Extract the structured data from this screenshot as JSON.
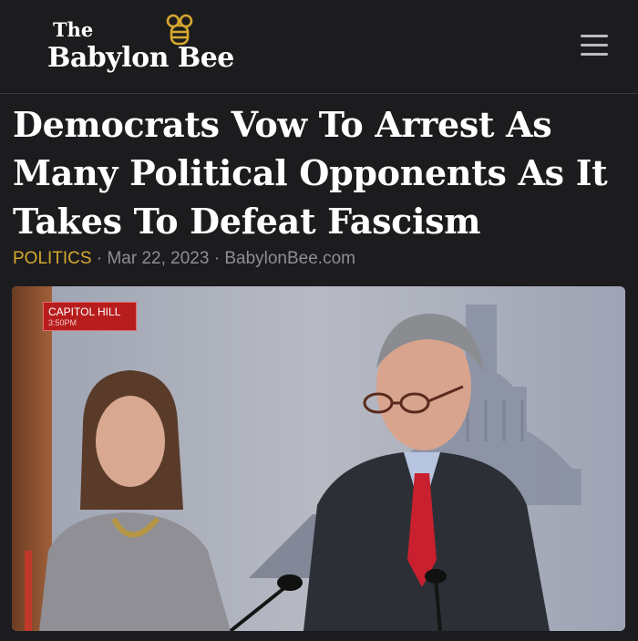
{
  "header": {
    "logo_the": "The",
    "logo_name": "Babylon Bee",
    "logo_icon": "bee-icon",
    "menu_icon": "hamburger-menu-icon"
  },
  "article": {
    "headline": "Democrats Vow To Arrest As Many Political Opponents As It Takes To Defeat Fascism",
    "category": "POLITICS",
    "separator": " · ",
    "date": "Mar 22, 2023",
    "source": "BabylonBee.com"
  },
  "photo": {
    "chyron_location": "CAPITOL HILL",
    "chyron_time": "3:50PM"
  },
  "colors": {
    "background": "#1c1c1f",
    "category": "#d7a82f",
    "meta": "#8e8e93",
    "chyron": "#b81d1d"
  }
}
